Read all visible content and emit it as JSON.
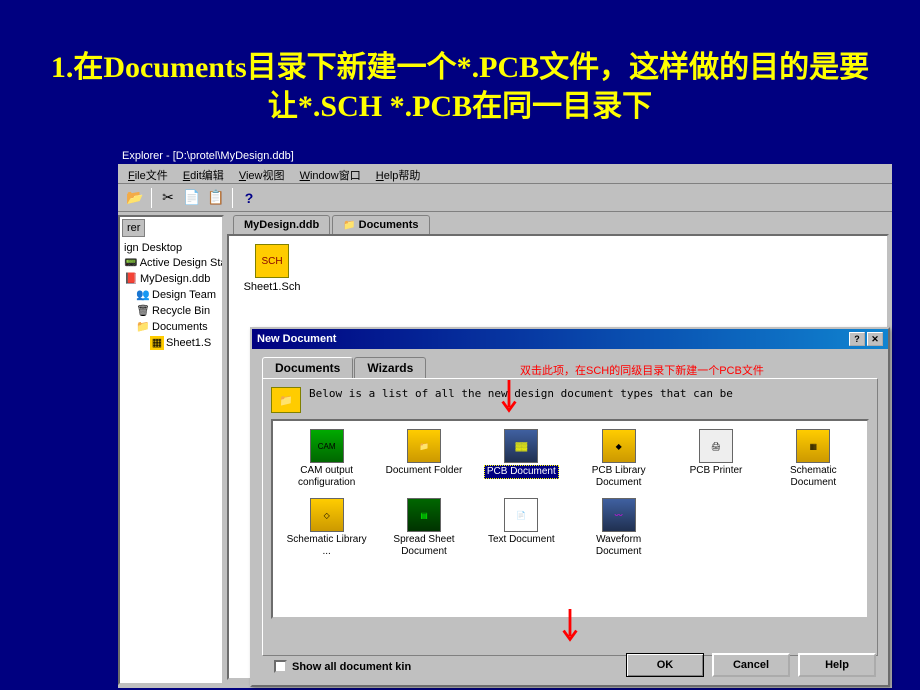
{
  "slide": {
    "title": "1.在Documents目录下新建一个*.PCB文件，这样做的目的是要让*.SCH *.PCB在同一目录下"
  },
  "app": {
    "titlebar": "Explorer - [D:\\protel\\MyDesign.ddb]",
    "menus": {
      "file": "File文件",
      "edit": "Edit编辑",
      "view": "View视图",
      "window": "Window窗口",
      "help": "Help帮助"
    },
    "toolbar_help": "?",
    "left_panel_tab": "rer",
    "tree": {
      "item0": "ign Desktop",
      "item1": "Active Design Sta",
      "item2": "MyDesign.ddb",
      "item3": "Design Team",
      "item4": "Recycle Bin",
      "item5": "Documents",
      "item6": "Sheet1.S"
    },
    "doc_tabs": {
      "tab1": "MyDesign.ddb",
      "tab2": "Documents"
    },
    "doc_file": "Sheet1.Sch"
  },
  "dialog": {
    "title": "New Document",
    "tabs": {
      "documents": "Documents",
      "wizards": "Wizards"
    },
    "info": "Below is a list of all the new design document types that can be",
    "doctypes": {
      "cam": "CAM output configuration",
      "folder": "Document Folder",
      "pcb": "PCB Document",
      "pcblib": "PCB Library Document",
      "printer": "PCB Printer",
      "sch": "Schematic Document",
      "schlib": "Schematic Library ...",
      "spread": "Spread Sheet Document",
      "text": "Text Document",
      "wave": "Waveform Document"
    },
    "checkbox": "Show all document kin",
    "buttons": {
      "ok": "OK",
      "cancel": "Cancel",
      "help": "Help"
    }
  },
  "annotation": {
    "text1": "双击此项，在SCH的同级目录下新建一个PCB文件"
  }
}
